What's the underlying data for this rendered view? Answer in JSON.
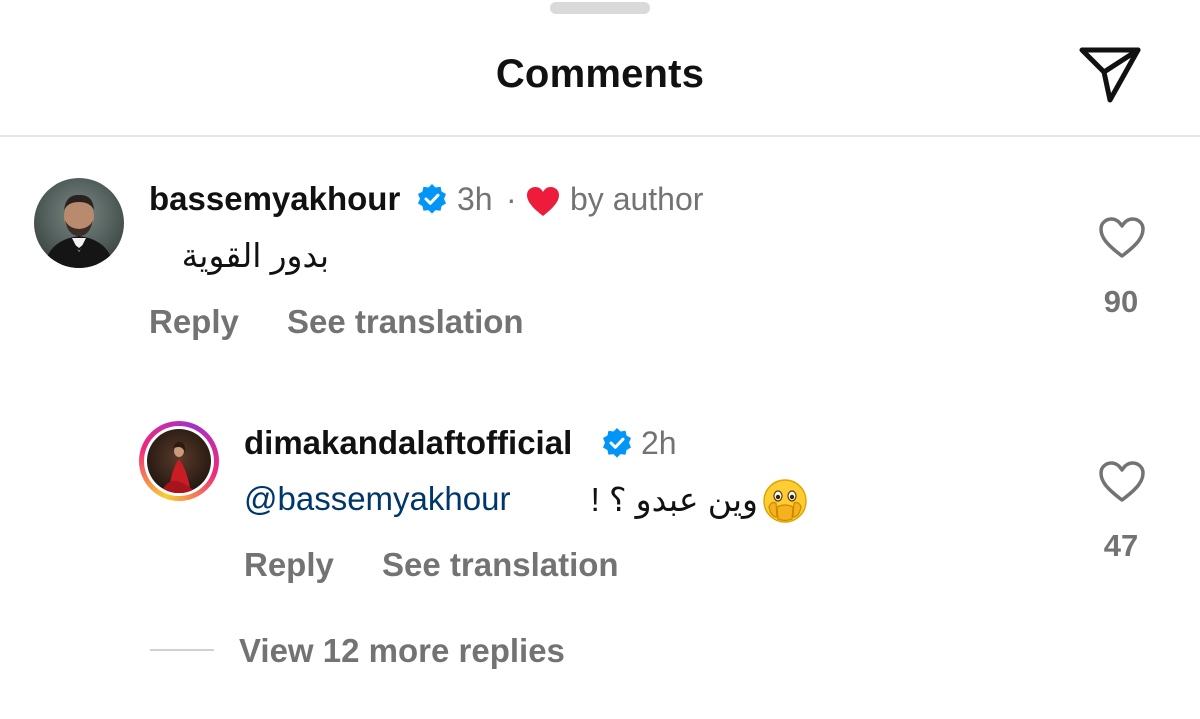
{
  "header": {
    "title": "Comments",
    "share_icon": "paper-plane-icon"
  },
  "comments": [
    {
      "username": "bassemyakhour",
      "verified": true,
      "time": "3h",
      "separator": "·",
      "liked_by_author_label": "by author",
      "text": "بدور القوية",
      "reply_label": "Reply",
      "translate_label": "See translation",
      "like_count": "90"
    },
    {
      "username": "dimakandalaftofficial",
      "verified": true,
      "time": "2h",
      "mention": "@bassemyakhour",
      "text": "وين عبدو ؟ !",
      "emoji": "face-with-open-eyes-and-hand-over-mouth",
      "reply_label": "Reply",
      "translate_label": "See translation",
      "like_count": "47"
    }
  ],
  "more_replies": {
    "label": "View 12 more replies"
  },
  "colors": {
    "text_primary": "#111111",
    "text_secondary": "#737373",
    "mention": "#00376b",
    "verified_blue": "#0095f6",
    "heart_red": "#ed1c3a"
  }
}
